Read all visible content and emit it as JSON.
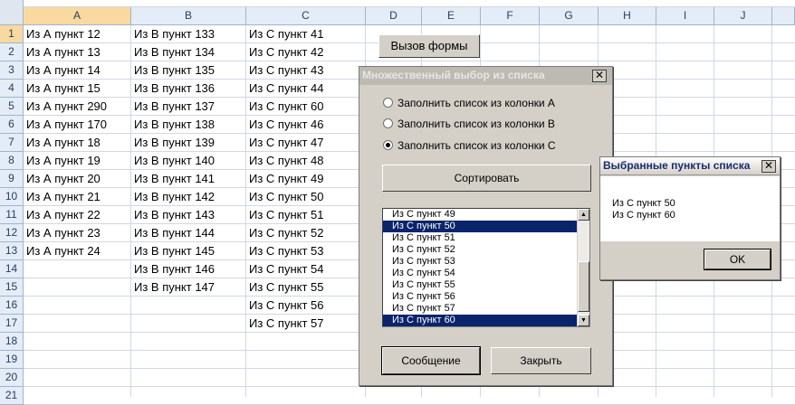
{
  "columns": [
    "A",
    "B",
    "C",
    "D",
    "E",
    "F",
    "G",
    "H",
    "I",
    "J"
  ],
  "rows": [
    "1",
    "2",
    "3",
    "4",
    "5",
    "6",
    "7",
    "8",
    "9",
    "10",
    "11",
    "12",
    "13",
    "14",
    "15",
    "16",
    "17",
    "18",
    "19",
    "20",
    "21"
  ],
  "colA": [
    "Из А пункт 12",
    "Из А пункт 13",
    "Из А пункт 14",
    "Из А пункт 15",
    "Из А пункт 290",
    "Из А пункт 170",
    "Из А пункт 18",
    "Из А пункт 19",
    "Из А пункт 20",
    "Из А пункт 21",
    "Из А пункт 22",
    "Из А пункт 23",
    "Из А пункт 24"
  ],
  "colB": [
    "Из В пункт 133",
    "Из В пункт 134",
    "Из В пункт 135",
    "Из В пункт 136",
    "Из В пункт 137",
    "Из В пункт 138",
    "Из В пункт 139",
    "Из В пункт 140",
    "Из В пункт 141",
    "Из В пункт 142",
    "Из В пункт 143",
    "Из В пункт 144",
    "Из В пункт 145",
    "Из В пункт 146",
    "Из В пункт 147"
  ],
  "colC": [
    "Из С пункт 41",
    "Из С пункт 42",
    "Из С пункт 43",
    "Из С пункт 44",
    "Из С пункт 60",
    "Из С пункт 46",
    "Из С пункт 47",
    "Из С пункт 48",
    "Из С пункт 49",
    "Из С пункт 50",
    "Из С пункт 51",
    "Из С пункт 52",
    "Из С пункт 53",
    "Из С пункт 54",
    "Из С пункт 55",
    "Из С пункт 56",
    "Из С пункт 57"
  ],
  "sheet_button": "Вызов формы",
  "main_dialog": {
    "title": "Множественный выбор из списка",
    "close": "✕",
    "radio_a": "Заполнить список из колонки А",
    "radio_b": "Заполнить список из колонки В",
    "radio_c": "Заполнить список из колонки С",
    "radio_selected": "C",
    "sort_button": "Сортировать",
    "list_items": [
      "Из С пункт 49",
      "Из С пункт 50",
      "Из С пункт 51",
      "Из С пункт 52",
      "Из С пункт 53",
      "Из С пункт 54",
      "Из С пункт 55",
      "Из С пункт 56",
      "Из С пункт 57",
      "Из С пункт 60"
    ],
    "list_selected": [
      "Из С пункт 50",
      "Из С пункт 60"
    ],
    "message_button": "Сообщение",
    "close_button": "Закрыть"
  },
  "msg_dialog": {
    "title": "Выбранные пункты списка",
    "close": "✕",
    "line1": "Из С пункт 50",
    "line2": "Из С пункт 60",
    "ok_button": "OK"
  },
  "colors": {
    "header_bg": "#e4ecf7",
    "selected_header": "#f9d99f",
    "list_selection": "#0a246a",
    "dialog_bg": "#d4d0c8"
  }
}
